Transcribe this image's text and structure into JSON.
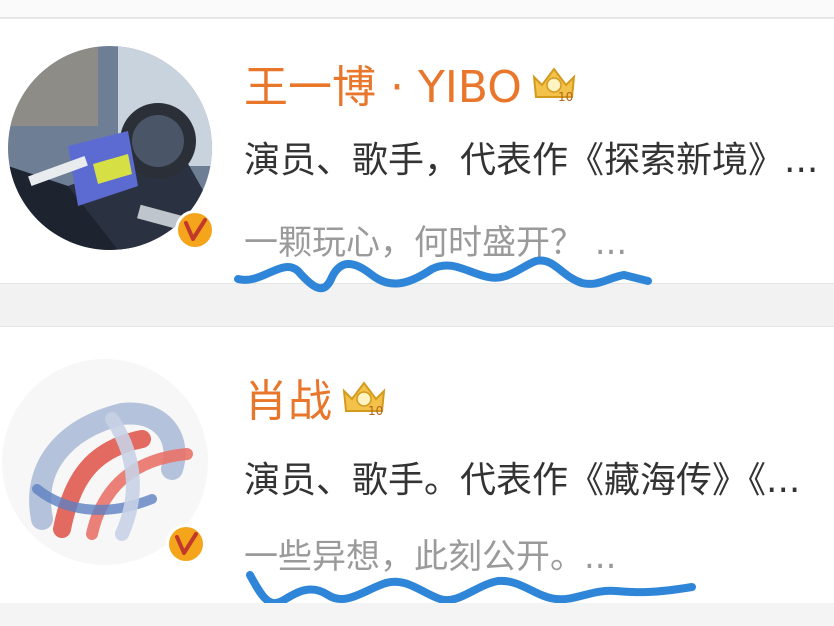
{
  "users": [
    {
      "name": "王一博 · YIBO",
      "description": "演员、歌手，代表作《探索新境》...",
      "slogan": "一颗玩心，何时盛开？ ...",
      "avatar_icon": "motorcycle-rider-avatar",
      "badge_icon": "verified-v-icon",
      "level_icon": "gold-crown-icon"
    },
    {
      "name": "肖战",
      "description": "演员、歌手。代表作《藏海传》《...",
      "slogan": "一些异想，此刻公开。...",
      "avatar_icon": "abstract-brushstroke-avatar",
      "badge_icon": "verified-v-icon",
      "level_icon": "gold-crown-icon"
    }
  ],
  "colors": {
    "name": "#e8762b",
    "description": "#333333",
    "slogan": "#9a9a9a",
    "badge": "#f4a51c",
    "annotation": "#2f86d8"
  }
}
